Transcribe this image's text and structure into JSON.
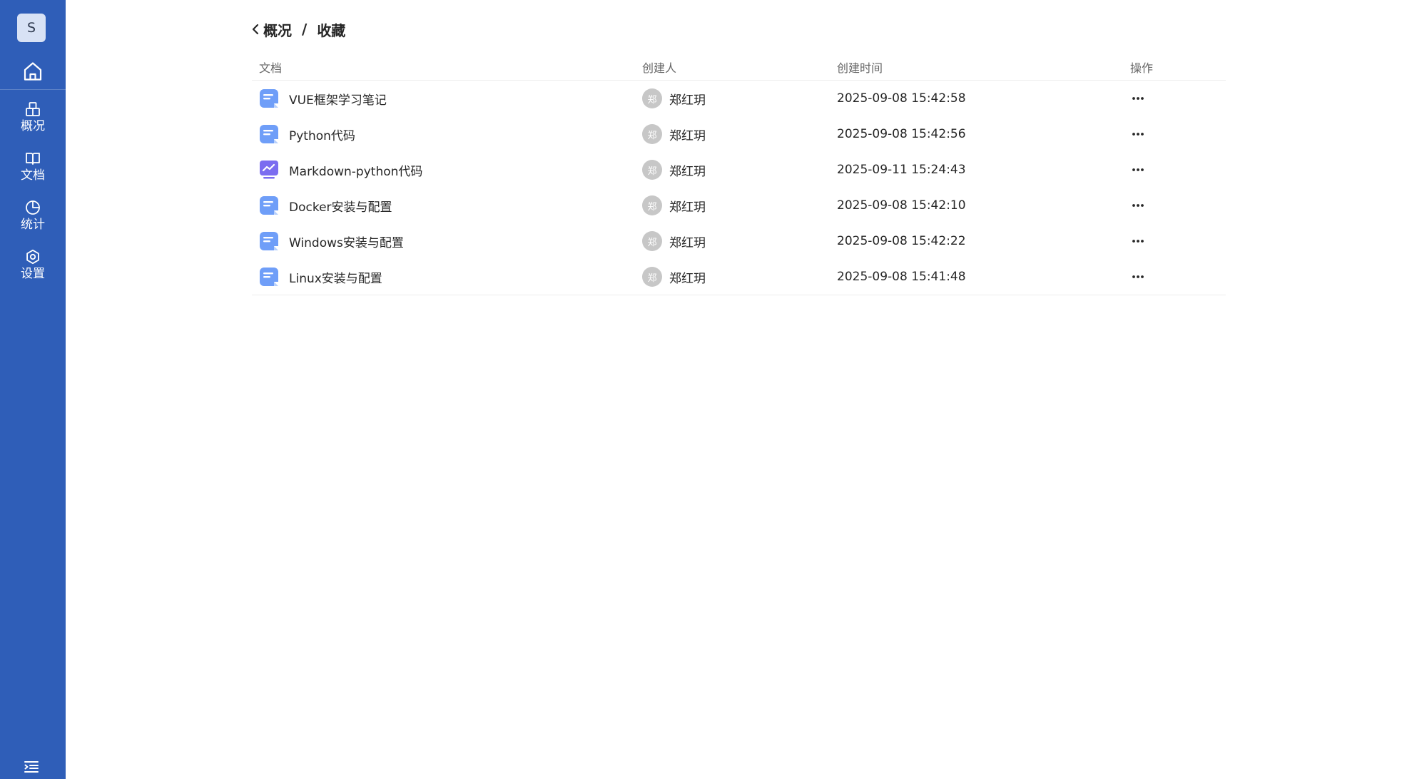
{
  "sidebar": {
    "avatar_letter": "S",
    "home_icon": "home-icon",
    "items": [
      {
        "label": "概况",
        "icon": "package-icon"
      },
      {
        "label": "文档",
        "icon": "book-icon"
      },
      {
        "label": "统计",
        "icon": "pie-chart-icon"
      },
      {
        "label": "设置",
        "icon": "gear-icon"
      }
    ],
    "collapse_icon": "menu-collapse-icon",
    "color": "#2f5eb8"
  },
  "breadcrumb": {
    "parent": "概况",
    "separator": "/",
    "current": "收藏"
  },
  "table": {
    "columns": {
      "doc": "文档",
      "creator": "创建人",
      "time": "创建时间",
      "op": "操作"
    },
    "rows": [
      {
        "name": "VUE框架学习笔记",
        "icon": "doc-icon",
        "creator_initial": "郑",
        "creator": "郑红玥",
        "time": "2025-09-08 15:42:58"
      },
      {
        "name": "Python代码",
        "icon": "doc-icon",
        "creator_initial": "郑",
        "creator": "郑红玥",
        "time": "2025-09-08 15:42:56"
      },
      {
        "name": "Markdown-python代码",
        "icon": "board-icon",
        "creator_initial": "郑",
        "creator": "郑红玥",
        "time": "2025-09-11 15:24:43"
      },
      {
        "name": "Docker安装与配置",
        "icon": "doc-icon",
        "creator_initial": "郑",
        "creator": "郑红玥",
        "time": "2025-09-08 15:42:10"
      },
      {
        "name": "Windows安装与配置",
        "icon": "doc-icon",
        "creator_initial": "郑",
        "creator": "郑红玥",
        "time": "2025-09-08 15:42:22"
      },
      {
        "name": "Linux安装与配置",
        "icon": "doc-icon",
        "creator_initial": "郑",
        "creator": "郑红玥",
        "time": "2025-09-08 15:41:48"
      }
    ]
  }
}
